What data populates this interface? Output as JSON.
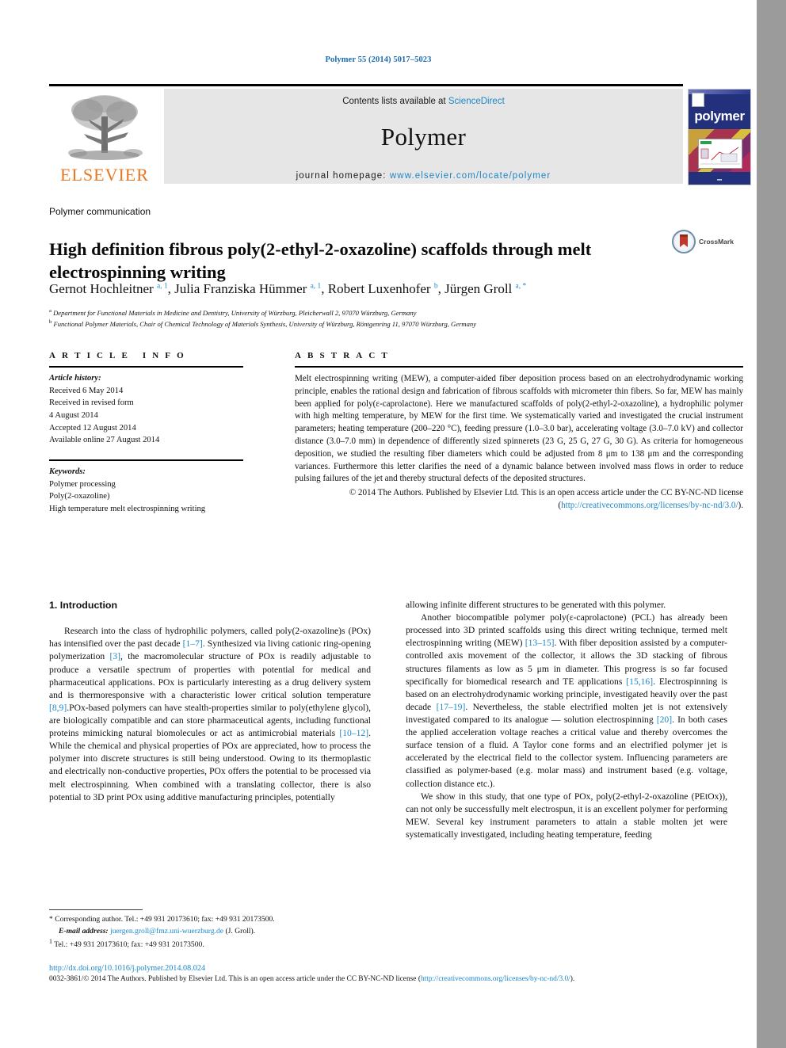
{
  "running_head": "Polymer 55 (2014) 5017–5023",
  "masthead": {
    "contents_prefix": "Contents lists available at ",
    "sciencedirect": "ScienceDirect",
    "journal_title": "Polymer",
    "homepage_label": "journal homepage: ",
    "homepage_url": "www.elsevier.com/locate/polymer",
    "publisher_logo_text": "ELSEVIER",
    "cover_word": "polymer"
  },
  "article": {
    "kind": "Polymer communication",
    "title": "High definition fibrous poly(2-ethyl-2-oxazoline) scaffolds through melt electrospinning writing",
    "crossmark_label": "CrossMark",
    "authors_html": "Gernot Hochleitner <sup>a, 1</sup>, Julia Franziska Hümmer <sup>a, 1</sup>, Robert Luxenhofer <sup>b</sup>, Jürgen Groll <sup>a, *</sup>",
    "affiliation_a": "Department for Functional Materials in Medicine and Dentistry, University of Würzburg, Pleicherwall 2, 97070 Würzburg, Germany",
    "affiliation_b": "Functional Polymer Materials, Chair of Chemical Technology of Materials Synthesis, University of Würzburg, Röntgenring 11, 97070 Würzburg, Germany"
  },
  "info": {
    "heading": "ARTICLE INFO",
    "history_label": "Article history:",
    "history": [
      "Received 6 May 2014",
      "Received in revised form",
      "4 August 2014",
      "Accepted 12 August 2014",
      "Available online 27 August 2014"
    ],
    "keywords_label": "Keywords:",
    "keywords": [
      "Polymer processing",
      "Poly(2-oxazoline)",
      "High temperature melt electrospinning writing"
    ]
  },
  "abstract": {
    "heading": "ABSTRACT",
    "body": "Melt electrospinning writing (MEW), a computer-aided fiber deposition process based on an electrohydrodynamic working principle, enables the rational design and fabrication of fibrous scaffolds with micrometer thin fibers. So far, MEW has mainly been applied for poly(ε-caprolactone). Here we manufactured scaffolds of poly(2-ethyl-2-oxazoline), a hydrophilic polymer with high melting temperature, by MEW for the first time. We systematically varied and investigated the crucial instrument parameters; heating temperature (200–220 °C), feeding pressure (1.0–3.0 bar), accelerating voltage (3.0–7.0 kV) and collector distance (3.0–7.0 mm) in dependence of differently sized spinnerets (23 G, 25 G, 27 G, 30 G). As criteria for homogeneous deposition, we studied the resulting fiber diameters which could be adjusted from 8 μm to 138 μm and the corresponding variances. Furthermore this letter clarifies the need of a dynamic balance between involved mass flows in order to reduce pulsing failures of the jet and thereby structural defects of the deposited structures.",
    "copyright_text": "© 2014 The Authors. Published by Elsevier Ltd. This is an open access article under the CC BY-NC-ND license (",
    "license_url": "http://creativecommons.org/licenses/by-nc-nd/3.0/",
    "copyright_tail": ")."
  },
  "body": {
    "section_title": "1. Introduction",
    "left_paragraphs": [
      {
        "segments": [
          {
            "t": "Research into the class of hydrophilic polymers, called poly(2-oxazoline)s (POx) has intensified over the past decade "
          },
          {
            "t": "[1–7]",
            "ref": true
          },
          {
            "t": ". Synthesized via living cationic ring-opening polymerization "
          },
          {
            "t": "[3]",
            "ref": true
          },
          {
            "t": ", the macromolecular structure of POx is readily adjustable to produce a versatile spectrum of properties with potential for medical and pharmaceutical applications. POx is particularly interesting as a drug delivery system and is thermoresponsive with a characteristic lower critical solution temperature "
          },
          {
            "t": "[8,9]",
            "ref": true
          },
          {
            "t": ".POx-based polymers can have stealth-properties similar to poly(ethylene glycol), are biologically compatible and can store pharmaceutical agents, including functional proteins mimicking natural biomolecules or act as antimicrobial materials "
          },
          {
            "t": "[10–12]",
            "ref": true
          },
          {
            "t": ". While the chemical and physical properties of POx are appreciated, how to process the polymer into discrete structures is still being understood. Owing to its thermoplastic and electrically non-conductive properties, POx offers the potential to be processed via melt electrospinning. When combined with a translating collector, there is also potential to 3D print POx using additive manufacturing principles, potentially"
          }
        ]
      }
    ],
    "right_paragraphs": [
      {
        "segments": [
          {
            "t": "allowing infinite different structures to be generated with this polymer.",
            "noindent": true
          }
        ]
      },
      {
        "segments": [
          {
            "t": "Another biocompatible polymer poly(ε-caprolactone) (PCL) has already been processed into 3D printed scaffolds using this direct writing technique, termed melt electrospinning writing (MEW) "
          },
          {
            "t": "[13–15]",
            "ref": true
          },
          {
            "t": ". With fiber deposition assisted by a computer-controlled axis movement of the collector, it allows the 3D stacking of fibrous structures filaments as low as 5 μm in diameter. This progress is so far focused specifically for biomedical research and TE applications "
          },
          {
            "t": "[15,16]",
            "ref": true
          },
          {
            "t": ". Electrospinning is based on an electrohydrodynamic working principle, investigated heavily over the past decade "
          },
          {
            "t": "[17–19]",
            "ref": true
          },
          {
            "t": ". Nevertheless, the stable electrified molten jet is not extensively investigated compared to its analogue — solution electrospinning "
          },
          {
            "t": "[20]",
            "ref": true
          },
          {
            "t": ". In both cases the applied acceleration voltage reaches a critical value and thereby overcomes the surface tension of a fluid. A Taylor cone forms and an electrified polymer jet is accelerated by the electrical field to the collector system. Influencing parameters are classified as polymer-based (e.g. molar mass) and instrument based (e.g. voltage, collection distance etc.)."
          }
        ]
      },
      {
        "segments": [
          {
            "t": "We show in this study, that one type of POx, poly(2-ethyl-2-oxazoline (PEtOx)), can not only be successfully melt electrospun, it is an excellent polymer for performing MEW. Several key instrument parameters to attain a stable molten jet were systematically investigated, including heating temperature, feeding"
          }
        ]
      }
    ]
  },
  "footnotes": {
    "corresponding": "* Corresponding author. Tel.: +49 931 20173610; fax: +49 931 20173500.",
    "email_label": "E-mail address:",
    "email": "juergen.groll@fmz.uni-wuerzburg.de",
    "email_suffix": "(J. Groll).",
    "note1": "Tel.: +49 931 20173610; fax: +49 931 20173500.",
    "note1_mark": "1"
  },
  "footer": {
    "doi": "http://dx.doi.org/10.1016/j.polymer.2014.08.024",
    "copyright_prefix": "0032-3861/© 2014 The Authors. Published by Elsevier Ltd. This is an open access article under the CC BY-NC-ND license (",
    "copyright_link": "http://creativecommons.org/licenses/by-nc-nd/3.0/",
    "copyright_suffix": ")."
  },
  "colors": {
    "link": "#1b87c9",
    "running_head": "#1b6bb0",
    "elsevier_orange": "#e87722",
    "panel_gray": "#e6e6e6",
    "gutter_gray": "#9b9b9b",
    "cover_blue": "#23307c"
  }
}
